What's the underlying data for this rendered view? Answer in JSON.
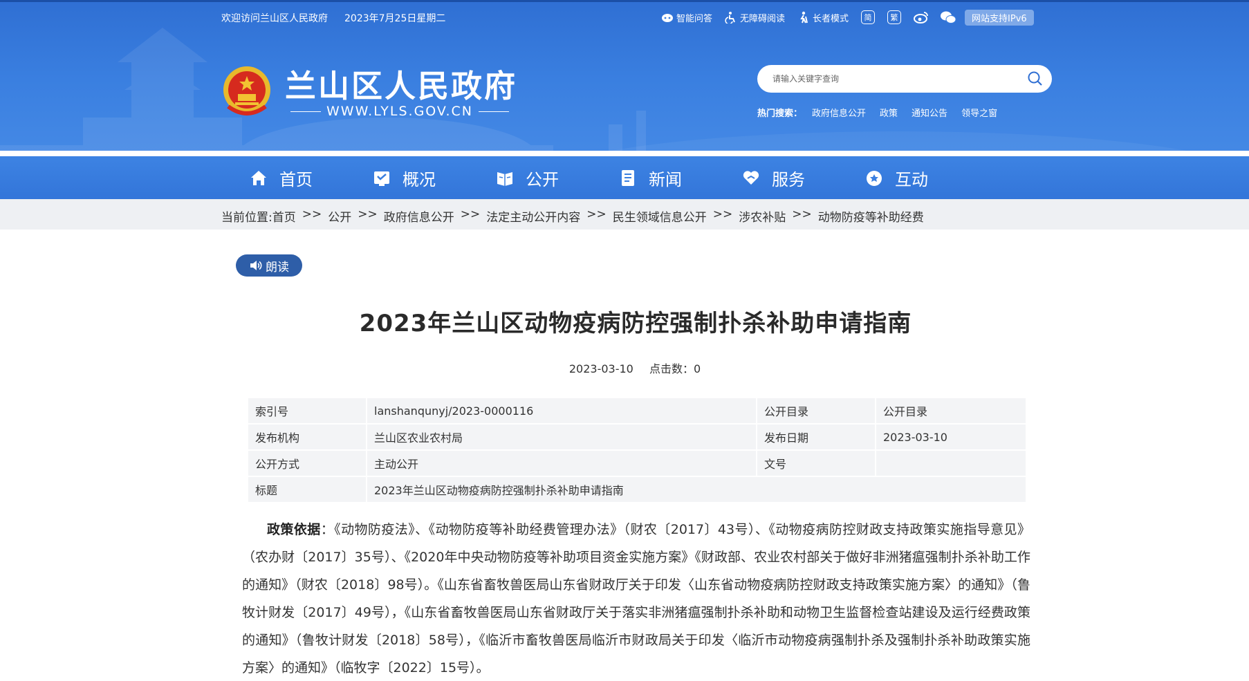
{
  "topbar": {
    "welcome": "欢迎访问兰山区人民政府",
    "date": "2023年7月25日星期二",
    "tools": [
      "智能问答",
      "无障碍阅读",
      "长者模式"
    ],
    "ipv6": "网站支持IPv6"
  },
  "site": {
    "title": "兰山区人民政府",
    "url": "WWW.LYLS.GOV.CN"
  },
  "search": {
    "placeholder": "请输入关键字查询",
    "hot_label": "热门搜索：",
    "hot": [
      "政府信息公开",
      "政策",
      "通知公告",
      "领导之窗"
    ]
  },
  "nav": {
    "items": [
      "首页",
      "概况",
      "公开",
      "新闻",
      "服务",
      "互动"
    ]
  },
  "breadcrumb": {
    "label": "当前位置: ",
    "items": [
      "首页",
      "公开",
      "政府信息公开",
      "法定主动公开内容",
      "民生领域信息公开",
      "涉农补贴",
      "动物防疫等补助经费"
    ],
    "sep": ">>"
  },
  "article": {
    "read_label": "朗读",
    "title": "2023年兰山区动物疫病防控强制扑杀补助申请指南",
    "date": "2023-03-10",
    "hits": "点击数：0",
    "info": [
      [
        "索引号",
        "lanshanqunyj/2023-0000116",
        "公开目录",
        "公开目录"
      ],
      [
        "发布机构",
        "兰山区农业农村局",
        "发布日期",
        "2023-03-10"
      ],
      [
        "公开方式",
        "主动公开",
        "文号",
        ""
      ]
    ],
    "title_row_label": "标题",
    "title_row_value": "2023年兰山区动物疫病防控强制扑杀补助申请指南",
    "body_label": "政策依据",
    "body_text": "：《动物防疫法》、《动物防疫等补助经费管理办法》（财农〔2017〕43号）、《动物疫病防控财政支持政策实施指导意见》（农办财〔2017〕35号）、《2020年中央动物防疫等补助项目资金实施方案》《财政部、农业农村部关于做好非洲猪瘟强制扑杀补助工作的通知》（财农〔2018〕98号）。《山东省畜牧兽医局山东省财政厅关于印发〈山东省动物疫病防控财政支持政策实施方案〉的通知》（鲁牧计财发〔2017〕49号），《山东省畜牧兽医局山东省财政厅关于落实非洲猪瘟强制扑杀补助和动物卫生监督检查站建设及运行经费政策的通知》（鲁牧计财发〔2018〕58号），《临沂市畜牧兽医局临沂市财政局关于印发〈临沂市动物疫病强制扑杀及强制扑杀补助政策实施方案〉的通知》（临牧字〔2022〕15号）。"
  },
  "colors": {
    "header_blue": "#3a7fe0",
    "read_button": "#2e5ea8",
    "crumb_bg": "#eef0f3",
    "table_bg": "#f3f4f6"
  },
  "icons": [
    "robot-icon",
    "accessibility-icon",
    "elder-icon",
    "simplified-icon",
    "traditional-icon",
    "weibo-icon",
    "wechat-icon",
    "search-icon",
    "home-icon",
    "overview-icon",
    "open-icon",
    "news-icon",
    "service-icon",
    "interact-icon",
    "speaker-icon",
    "national-emblem"
  ]
}
